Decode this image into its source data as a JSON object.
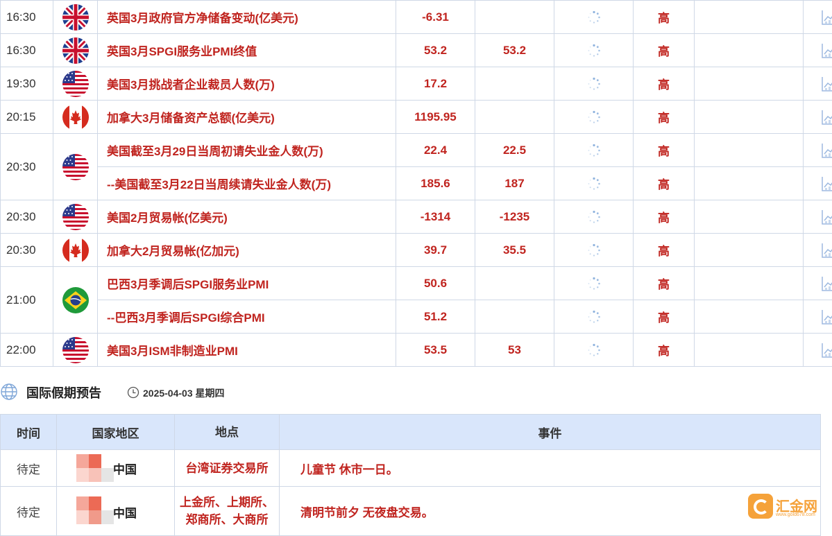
{
  "events": [
    {
      "time": "16:30",
      "flag": "uk",
      "title": "英国3月政府官方净储备变动(亿美元)",
      "previous": "-6.31",
      "forecast": "",
      "importance": "高"
    },
    {
      "time": "16:30",
      "flag": "uk",
      "title": "英国3月SPGI服务业PMI终值",
      "previous": "53.2",
      "forecast": "53.2",
      "importance": "高"
    },
    {
      "time": "19:30",
      "flag": "us",
      "title": "美国3月挑战者企业裁员人数(万)",
      "previous": "17.2",
      "forecast": "",
      "importance": "高"
    },
    {
      "time": "20:15",
      "flag": "ca",
      "title": "加拿大3月储备资产总额(亿美元)",
      "previous": "1195.95",
      "forecast": "",
      "importance": "高"
    },
    {
      "time": "20:30",
      "flag": "us",
      "title": "美国截至3月29日当周初请失业金人数(万)",
      "previous": "22.4",
      "forecast": "22.5",
      "importance": "高"
    },
    {
      "time": "",
      "flag": "",
      "title": "--美国截至3月22日当周续请失业金人数(万)",
      "previous": "185.6",
      "forecast": "187",
      "importance": "高"
    },
    {
      "time": "20:30",
      "flag": "us",
      "title": "美国2月贸易帐(亿美元)",
      "previous": "-1314",
      "forecast": "-1235",
      "importance": "高"
    },
    {
      "time": "20:30",
      "flag": "ca",
      "title": "加拿大2月贸易帐(亿加元)",
      "previous": "39.7",
      "forecast": "35.5",
      "importance": "高"
    },
    {
      "time": "21:00",
      "flag": "br",
      "title": "巴西3月季调后SPGI服务业PMI",
      "previous": "50.6",
      "forecast": "",
      "importance": "高"
    },
    {
      "time": "",
      "flag": "",
      "title": "--巴西3月季调后SPGI综合PMI",
      "previous": "51.2",
      "forecast": "",
      "importance": "高"
    },
    {
      "time": "22:00",
      "flag": "us",
      "title": "美国3月ISM非制造业PMI",
      "previous": "53.5",
      "forecast": "53",
      "importance": "高"
    }
  ],
  "holiday": {
    "title": "国际假期预告",
    "date": "2025-04-03 星期四",
    "headers": {
      "time": "时间",
      "country": "国家地区",
      "place": "地点",
      "event": "事件"
    },
    "rows": [
      {
        "time": "待定",
        "country": "中国",
        "place": "台湾证券交易所",
        "event": "儿童节 休市一日。"
      },
      {
        "time": "待定",
        "country": "中国",
        "place": "上金所、上期所、郑商所、大商所",
        "event": "清明节前夕 无夜盘交易。"
      }
    ]
  },
  "watermark": {
    "name": "汇金网",
    "url": "www.gold678.com"
  },
  "colors": {
    "accent_red": "#c0241f",
    "header_bg": "#d9e6fb",
    "border": "#cfd8e6",
    "watermark": "#f5a23a"
  }
}
